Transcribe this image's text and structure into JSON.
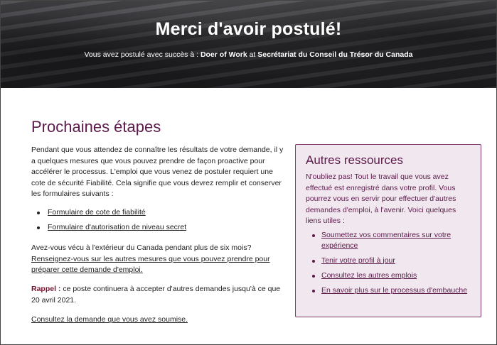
{
  "hero": {
    "title": "Merci d'avoir postulé!",
    "sub_prefix": "Vous avez postulé avec succès à : ",
    "job": "Doer of Work",
    "sub_at": " at ",
    "department": "Secrétariat du Conseil du Trésor du Canada"
  },
  "next_steps": {
    "heading": "Prochaines étapes",
    "intro": "Pendant que vous attendez de connaître les résultats de votre demande, il y a quelques mesures que vous pouvez prendre de façon proactive pour accélérer le processus. L'emploi que vous venez de postuler requiert une cote de sécurité Fiabilité. Cela signifie que vous devrez remplir et conserver les formulaires suivants :",
    "forms": [
      "Formulaire de cote de fiabilité",
      "Formulaire d'autorisation de niveau secret"
    ],
    "abroad_question": "Avez-vous vécu à l'extérieur du Canada pendant plus de six mois?",
    "abroad_link": "Renseignez-vous sur les autres mesures que vous pouvez prendre pour préparer cette demande d'emploi.",
    "reminder_label": "Rappel :",
    "reminder_text": " ce poste continuera à accepter d'autres demandes jusqu'à ce que 20 avril 2021.",
    "review_link": "Consultez la demande que vous avez soumise."
  },
  "resources": {
    "heading": "Autres ressources",
    "text": "N'oubliez pas! Tout le travail que vous avez effectué est enregistré dans votre profil. Vous pourrez vous en servir pour effectuer d'autres demandes d'emploi, à l'avenir. Voici quelques liens utiles :",
    "links": [
      "Soumettez vos commentaires sur votre expérience",
      "Tenir votre profil à jour",
      "Consultez les autres emplois",
      "En savoir plus sur le processus d'embauche"
    ]
  },
  "colors": {
    "accent": "#5c1a4a",
    "reminder": "#7a1330",
    "aside_bg": "#f1e7ef"
  }
}
